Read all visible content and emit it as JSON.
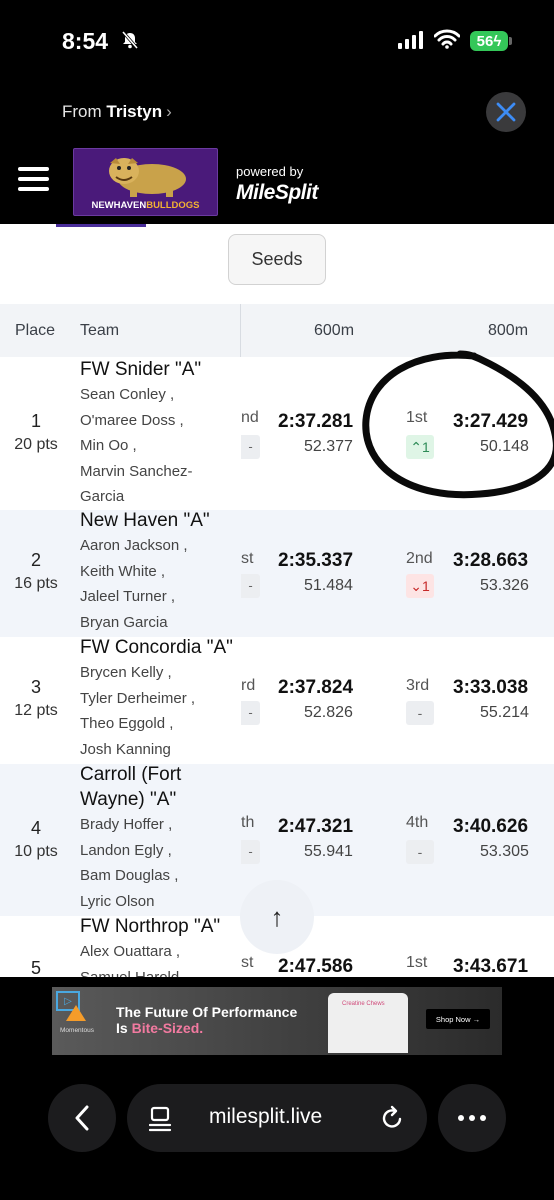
{
  "status_bar": {
    "time": "8:54",
    "battery": "56"
  },
  "share": {
    "from_prefix": "From ",
    "from_name": "Tristyn",
    "chevron": "›"
  },
  "header": {
    "logo_text_1": "NEWHAVEN",
    "logo_text_2": "BULLDOGS",
    "powered_by": "powered by",
    "brand": "MileSplit"
  },
  "seeds_button": "Seeds",
  "table": {
    "headers": {
      "place": "Place",
      "team": "Team",
      "split_1": "600m",
      "split_2": "800m"
    },
    "rows": [
      {
        "place": "1",
        "points": "20 pts",
        "team": "FW Snider \"A\"",
        "runners": [
          "Sean Conley ,",
          "O'maree Doss ,",
          "Min Oo ,",
          "Marvin Sanchez-",
          "Garcia"
        ],
        "a_place": "nd",
        "a_time": "2:37.281",
        "a_split": "52.377",
        "a_chip": "-",
        "b_place": "1st",
        "b_time": "3:27.429",
        "b_split": "50.148",
        "b_chip": "⌃1",
        "b_chip_kind": "up"
      },
      {
        "place": "2",
        "points": "16 pts",
        "team": "New Haven \"A\"",
        "runners": [
          "Aaron Jackson ,",
          "Keith White ,",
          "Jaleel Turner ,",
          "Bryan Garcia"
        ],
        "a_place": "st",
        "a_time": "2:35.337",
        "a_split": "51.484",
        "a_chip": "-",
        "b_place": "2nd",
        "b_time": "3:28.663",
        "b_split": "53.326",
        "b_chip": "⌄1",
        "b_chip_kind": "down"
      },
      {
        "place": "3",
        "points": "12 pts",
        "team": "FW Concordia \"A\"",
        "runners": [
          "Brycen Kelly ,",
          "Tyler Derheimer ,",
          "Theo Eggold ,",
          "Josh Kanning"
        ],
        "a_place": "rd",
        "a_time": "2:37.824",
        "a_split": "52.826",
        "a_chip": "-",
        "b_place": "3rd",
        "b_time": "3:33.038",
        "b_split": "55.214",
        "b_chip": "-",
        "b_chip_kind": "same"
      },
      {
        "place": "4",
        "points": "10 pts",
        "team_line_1": "Carroll (Fort",
        "team_line_2": "Wayne) \"A\"",
        "runners": [
          "Brady Hoffer ,",
          "Landon Egly ,",
          "Bam Douglas ,",
          "Lyric Olson"
        ],
        "a_place": "th",
        "a_time": "2:47.321",
        "a_split": "55.941",
        "a_chip": "-",
        "b_place": "4th",
        "b_time": "3:40.626",
        "b_split": "53.305",
        "b_chip": "-",
        "b_chip_kind": "same"
      },
      {
        "place": "5",
        "team": "FW Northrop \"A\"",
        "runners": [
          "Alex Ouattara ,",
          "Samuel Harold"
        ],
        "a_place": "st",
        "a_time": "2:47.586",
        "b_place": "1st",
        "b_time": "3:43.671"
      }
    ]
  },
  "scroll_top_glyph": "↑",
  "ad": {
    "headline_1": "The Future Of Performance",
    "headline_2a": "Is ",
    "headline_2b": "Bite-Sized.",
    "brand": "Momentous",
    "cta": "Shop Now  →",
    "product": "Creatine Chews"
  },
  "browser": {
    "url": "milesplit.live"
  },
  "colors": {
    "accent_purple": "#4a2d9a",
    "up_green": "#2e8b57",
    "down_red": "#c62828"
  }
}
